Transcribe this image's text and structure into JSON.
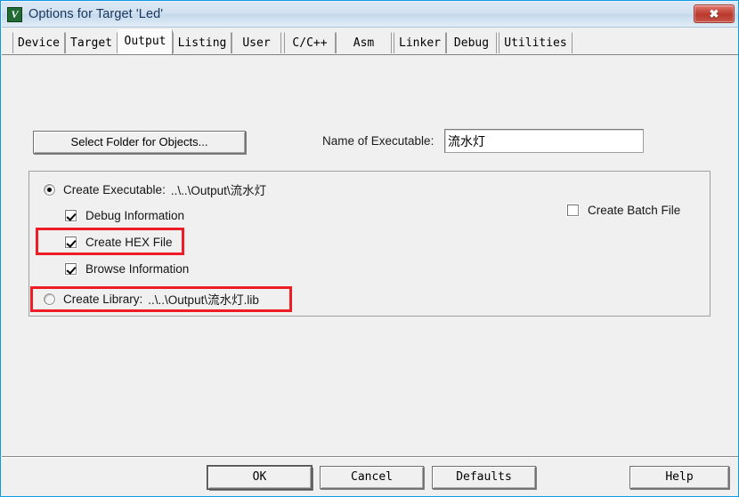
{
  "window": {
    "title": "Options for Target 'Led'",
    "app_icon": "keil-uvision-icon",
    "close_label": "✖",
    "accent_border": "#0a9ae8",
    "titlebar_text_color": "#17365d",
    "annotation_color": "#ee1c25"
  },
  "tabs": [
    {
      "label": "Device",
      "selected": false
    },
    {
      "label": "Target",
      "selected": false
    },
    {
      "label": "Output",
      "selected": true
    },
    {
      "label": "Listing",
      "selected": false
    },
    {
      "label": "User",
      "selected": false
    },
    {
      "label": "C/C++",
      "selected": false
    },
    {
      "label": "Asm",
      "selected": false
    },
    {
      "label": "Linker",
      "selected": false
    },
    {
      "label": "Debug",
      "selected": false
    },
    {
      "label": "Utilities",
      "selected": false
    }
  ],
  "output_page": {
    "select_folder_button": "Select Folder for Objects...",
    "executable_name_label": "Name of Executable:",
    "executable_name_value": "流水灯",
    "executable_name_placeholder": "",
    "create_executable": {
      "label": "Create Executable:",
      "path": "..\\..\\Output\\流水灯",
      "selected": true
    },
    "debug_information": {
      "label": "Debug Information",
      "checked": true
    },
    "create_hex_file": {
      "label": "Create HEX File",
      "checked": true
    },
    "browse_information": {
      "label": "Browse Information",
      "checked": true
    },
    "create_library": {
      "label": "Create Library:",
      "path": "..\\..\\Output\\流水灯.lib",
      "selected": false
    },
    "create_batch_file": {
      "label": "Create Batch File",
      "checked": false
    }
  },
  "footer": {
    "ok": "OK",
    "cancel": "Cancel",
    "defaults": "Defaults",
    "help": "Help"
  }
}
